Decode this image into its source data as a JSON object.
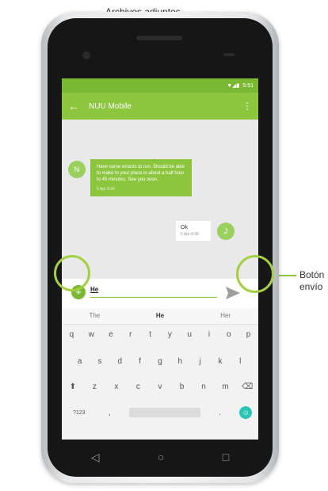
{
  "callouts": {
    "attachments": "Archivos adjuntos",
    "send_line1": "Botón",
    "send_line2": "envío"
  },
  "status": {
    "time": "5:51",
    "icons": "▼◢▮"
  },
  "appbar": {
    "back_icon": "←",
    "title": "NUU Mobile",
    "menu_icon": "⋮"
  },
  "messages": [
    {
      "avatar": "N",
      "text": "Have some errants to run. Should be able to make to your place in about a half hour to 45 minutes. See you soon.",
      "time": "5 Apr 8:34"
    },
    {
      "avatar": "J",
      "text": "Ok",
      "time": "5 Apr 8:38"
    }
  ],
  "composer": {
    "add_icon": "+",
    "typed_text": "He",
    "send_icon": "send-icon"
  },
  "keyboard": {
    "suggestions": [
      "The",
      "He",
      "Her"
    ],
    "row1": [
      "q",
      "w",
      "e",
      "r",
      "t",
      "y",
      "u",
      "i",
      "o",
      "p"
    ],
    "row2": [
      "a",
      "s",
      "d",
      "f",
      "g",
      "h",
      "j",
      "k",
      "l"
    ],
    "row3": [
      "z",
      "x",
      "c",
      "v",
      "b",
      "n",
      "m"
    ],
    "shift_icon": "⬆",
    "backspace_icon": "⌫",
    "symbols_label": "?123",
    "comma": ",",
    "period": ".",
    "emoji_icon": "☺"
  },
  "nav": {
    "back_icon": "◁",
    "home_icon": "○",
    "recents_icon": "□"
  },
  "colors": {
    "accent": "#8cc63f",
    "callout": "#a5cf43",
    "emoji": "#2bc4b5"
  }
}
